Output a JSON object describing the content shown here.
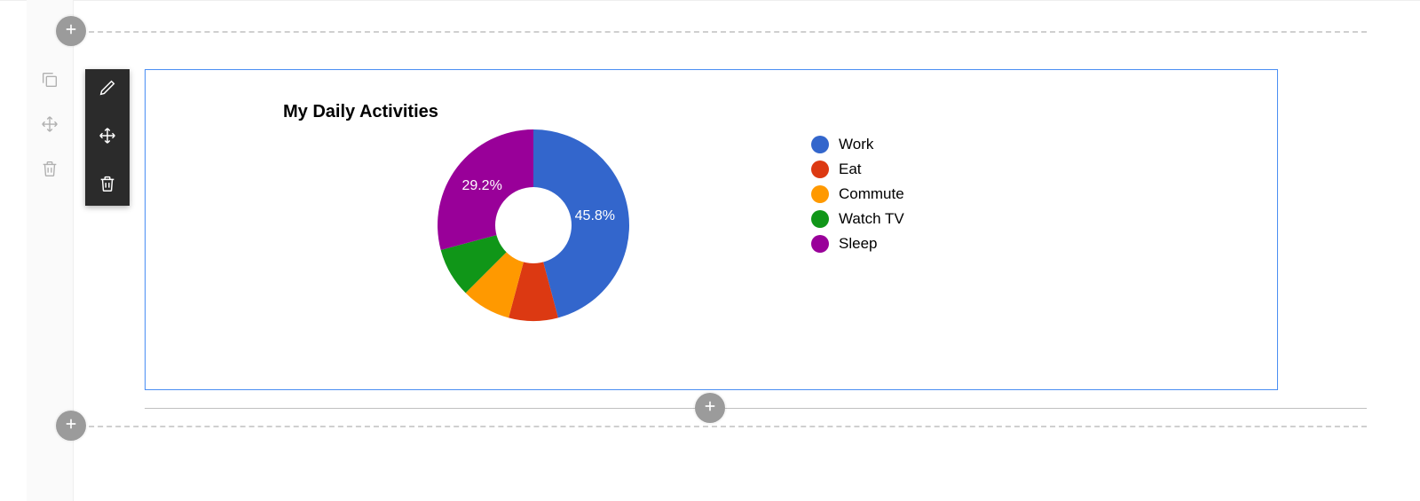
{
  "chart_data": {
    "type": "pie",
    "title": "My Daily Activities",
    "series": [
      {
        "name": "Work",
        "value": 11,
        "percent": 45.8,
        "color": "#3366cc"
      },
      {
        "name": "Eat",
        "value": 2,
        "percent": 8.3,
        "color": "#dc3912"
      },
      {
        "name": "Commute",
        "value": 2,
        "percent": 8.3,
        "color": "#ff9900"
      },
      {
        "name": "Watch TV",
        "value": 2,
        "percent": 8.3,
        "color": "#109618"
      },
      {
        "name": "Sleep",
        "value": 7,
        "percent": 29.2,
        "color": "#990099"
      }
    ],
    "visible_slice_labels": {
      "work_label": "45.8%",
      "sleep_label": "29.2%"
    }
  },
  "toolbar": {
    "edit": "edit",
    "move": "move",
    "delete": "delete"
  },
  "rail": {
    "copy": "copy",
    "move": "move",
    "delete": "delete"
  },
  "handles": {
    "add_row": "add"
  }
}
